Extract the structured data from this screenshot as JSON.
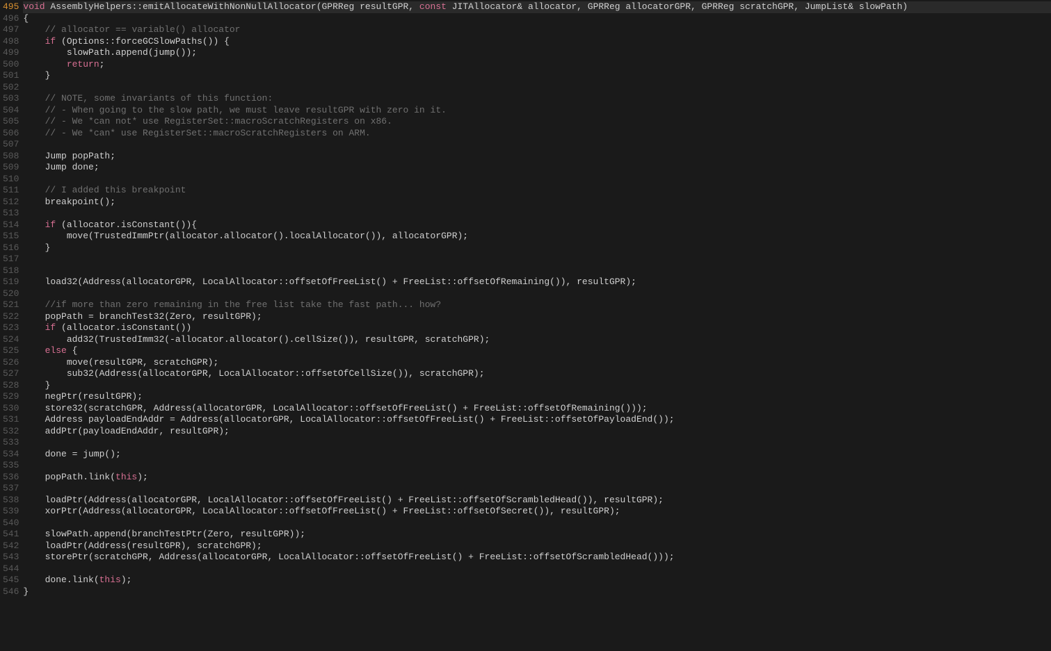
{
  "startLine": 495,
  "currentLine": 495,
  "lines": [
    {
      "n": 495,
      "html": "<span class='kw'>void</span> AssemblyHelpers::emitAllocateWithNonNullAllocator(GPRReg resultGPR, <span class='kw'>const</span> JITAllocator&amp; allocator, GPRReg allocatorGPR, GPRReg scratchGPR, JumpList&amp; slowPath)"
    },
    {
      "n": 496,
      "html": "{"
    },
    {
      "n": 497,
      "html": "    <span class='comment'>// allocator == variable() allocator</span>"
    },
    {
      "n": 498,
      "html": "    <span class='kw'>if</span> (Options::forceGCSlowPaths()) {"
    },
    {
      "n": 499,
      "html": "        slowPath.append(jump());"
    },
    {
      "n": 500,
      "html": "        <span class='kw'>return</span>;"
    },
    {
      "n": 501,
      "html": "    }"
    },
    {
      "n": 502,
      "html": ""
    },
    {
      "n": 503,
      "html": "    <span class='comment'>// NOTE, some invariants of this function:</span>"
    },
    {
      "n": 504,
      "html": "    <span class='comment'>// - When going to the slow path, we must leave resultGPR with zero in it.</span>"
    },
    {
      "n": 505,
      "html": "    <span class='comment'>// - We *can not* use RegisterSet::macroScratchRegisters on x86.</span>"
    },
    {
      "n": 506,
      "html": "    <span class='comment'>// - We *can* use RegisterSet::macroScratchRegisters on ARM.</span>"
    },
    {
      "n": 507,
      "html": ""
    },
    {
      "n": 508,
      "html": "    Jump popPath;"
    },
    {
      "n": 509,
      "html": "    Jump done;"
    },
    {
      "n": 510,
      "html": ""
    },
    {
      "n": 511,
      "html": "    <span class='comment'>// I added this breakpoint</span>"
    },
    {
      "n": 512,
      "html": "    breakpoint();"
    },
    {
      "n": 513,
      "html": ""
    },
    {
      "n": 514,
      "html": "    <span class='kw'>if</span> (allocator.isConstant()){"
    },
    {
      "n": 515,
      "html": "        move(TrustedImmPtr(allocator.allocator().localAllocator()), allocatorGPR);"
    },
    {
      "n": 516,
      "html": "    }"
    },
    {
      "n": 517,
      "html": ""
    },
    {
      "n": 518,
      "html": ""
    },
    {
      "n": 519,
      "html": "    load32(Address(allocatorGPR, LocalAllocator::offsetOfFreeList() + FreeList::offsetOfRemaining()), resultGPR);"
    },
    {
      "n": 520,
      "html": ""
    },
    {
      "n": 521,
      "html": "    <span class='comment'>//if more than zero remaining in the free list take the fast path... how?</span>"
    },
    {
      "n": 522,
      "html": "    popPath = branchTest32(Zero, resultGPR);"
    },
    {
      "n": 523,
      "html": "    <span class='kw'>if</span> (allocator.isConstant())"
    },
    {
      "n": 524,
      "html": "        add32(TrustedImm32(-allocator.allocator().cellSize()), resultGPR, scratchGPR);"
    },
    {
      "n": 525,
      "html": "    <span class='kw'>else</span> {"
    },
    {
      "n": 526,
      "html": "        move(resultGPR, scratchGPR);"
    },
    {
      "n": 527,
      "html": "        sub32(Address(allocatorGPR, LocalAllocator::offsetOfCellSize()), scratchGPR);"
    },
    {
      "n": 528,
      "html": "    }"
    },
    {
      "n": 529,
      "html": "    negPtr(resultGPR);"
    },
    {
      "n": 530,
      "html": "    store32(scratchGPR, Address(allocatorGPR, LocalAllocator::offsetOfFreeList() + FreeList::offsetOfRemaining()));"
    },
    {
      "n": 531,
      "html": "    Address payloadEndAddr = Address(allocatorGPR, LocalAllocator::offsetOfFreeList() + FreeList::offsetOfPayloadEnd());"
    },
    {
      "n": 532,
      "html": "    addPtr(payloadEndAddr, resultGPR);"
    },
    {
      "n": 533,
      "html": ""
    },
    {
      "n": 534,
      "html": "    done = jump();"
    },
    {
      "n": 535,
      "html": ""
    },
    {
      "n": 536,
      "html": "    popPath.link(<span class='this'>this</span>);"
    },
    {
      "n": 537,
      "html": ""
    },
    {
      "n": 538,
      "html": "    loadPtr(Address(allocatorGPR, LocalAllocator::offsetOfFreeList() + FreeList::offsetOfScrambledHead()), resultGPR);"
    },
    {
      "n": 539,
      "html": "    xorPtr(Address(allocatorGPR, LocalAllocator::offsetOfFreeList() + FreeList::offsetOfSecret()), resultGPR);"
    },
    {
      "n": 540,
      "html": ""
    },
    {
      "n": 541,
      "html": "    slowPath.append(branchTestPtr(Zero, resultGPR));"
    },
    {
      "n": 542,
      "html": "    loadPtr(Address(resultGPR), scratchGPR);"
    },
    {
      "n": 543,
      "html": "    storePtr(scratchGPR, Address(allocatorGPR, LocalAllocator::offsetOfFreeList() + FreeList::offsetOfScrambledHead()));"
    },
    {
      "n": 544,
      "html": ""
    },
    {
      "n": 545,
      "html": "    done.link(<span class='this'>this</span>);"
    },
    {
      "n": 546,
      "html": "}"
    }
  ]
}
